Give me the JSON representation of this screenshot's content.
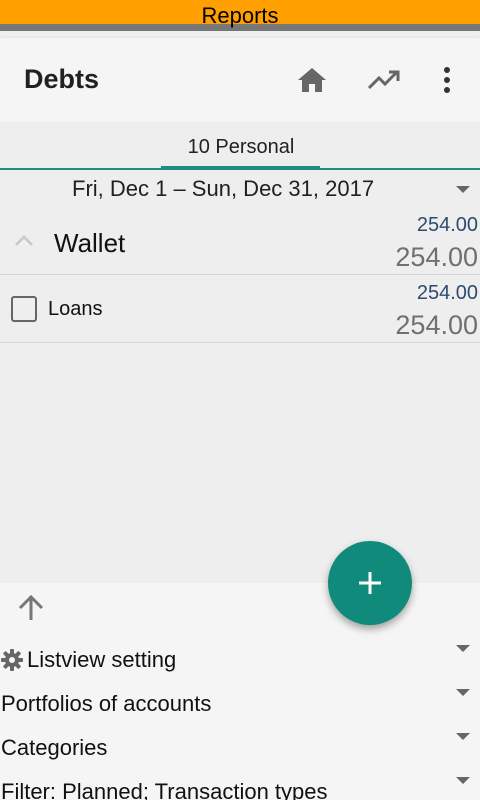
{
  "banner": {
    "title": "Reports"
  },
  "appbar": {
    "title": "Debts",
    "icons": [
      "home-icon",
      "trending-up-icon",
      "more-vert-icon"
    ]
  },
  "tabs": [
    {
      "label": "10 Personal",
      "selected": true
    }
  ],
  "date_range": "Fri, Dec 1 – Sun, Dec 31, 2017",
  "groups": [
    {
      "label": "Wallet",
      "amount_top": "254.00",
      "amount_main": "254.00",
      "expanded": true
    }
  ],
  "items": [
    {
      "label": "Loans",
      "amount_top": "254.00",
      "amount_main": "254.00",
      "checked": false
    }
  ],
  "fab": {
    "icon": "plus-icon"
  },
  "bottom_panel": {
    "settings": [
      {
        "label": "Listview setting",
        "icon": "gear-icon"
      },
      {
        "label": "Portfolios of accounts"
      },
      {
        "label": "Categories"
      },
      {
        "label": "Filter: Planned; Transaction types"
      }
    ]
  },
  "colors": {
    "banner": "#ffa000",
    "accent": "#1e8e80",
    "fab": "#0f8a7b",
    "amount_top": "#2e4a6e"
  }
}
